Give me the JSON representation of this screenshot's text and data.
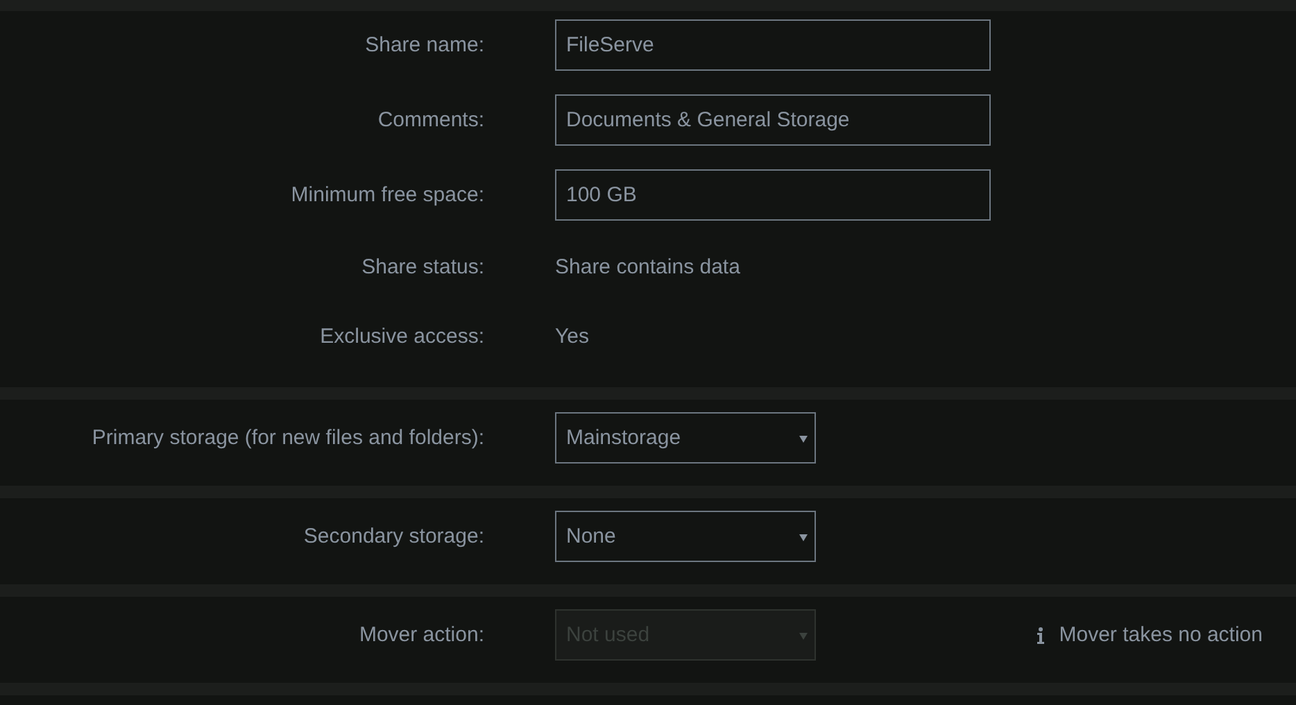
{
  "sections": [
    {
      "rows": [
        {
          "kind": "input",
          "label": "Share name:",
          "value": "FileServe"
        },
        {
          "kind": "input",
          "label": "Comments:",
          "value": "Documents & General Storage"
        },
        {
          "kind": "input",
          "label": "Minimum free space:",
          "value": "100 GB"
        },
        {
          "kind": "text",
          "label": "Share status:",
          "value": "Share contains data"
        },
        {
          "kind": "text",
          "label": "Exclusive access:",
          "value": "Yes"
        }
      ]
    },
    {
      "rows": [
        {
          "kind": "select",
          "label": "Primary storage (for new files and folders):",
          "value": "Mainstorage",
          "disabled": false
        }
      ]
    },
    {
      "rows": [
        {
          "kind": "select",
          "label": "Secondary storage:",
          "value": "None",
          "disabled": false
        }
      ]
    },
    {
      "rows": [
        {
          "kind": "select",
          "label": "Mover action:",
          "value": "Not used",
          "disabled": true,
          "note": "Mover takes no action"
        }
      ]
    }
  ]
}
